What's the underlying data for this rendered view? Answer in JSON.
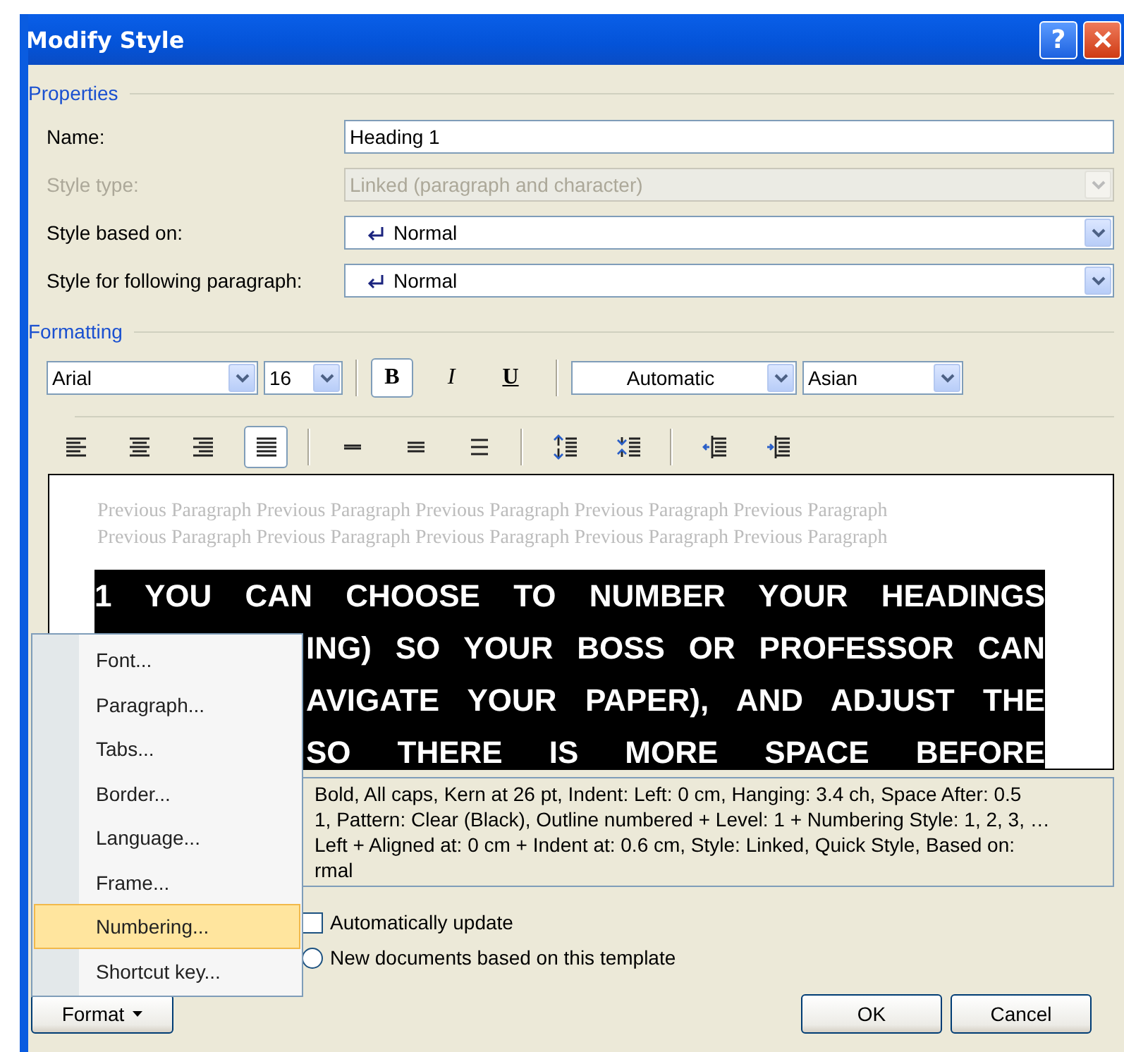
{
  "window": {
    "title": "Modify Style",
    "help": "?"
  },
  "properties": {
    "legend": "Properties",
    "fields": [
      {
        "label": "Name:",
        "kind": "text",
        "value": "Heading 1",
        "disabled": false
      },
      {
        "label": "Style type:",
        "kind": "select",
        "value": "Linked (paragraph and character)",
        "disabled": true
      },
      {
        "label": "Style based on:",
        "kind": "style-select",
        "value": "Normal",
        "disabled": false
      },
      {
        "label": "Style for following paragraph:",
        "kind": "style-select",
        "value": "Normal",
        "disabled": false
      }
    ]
  },
  "formatting": {
    "legend": "Formatting",
    "font": "Arial",
    "size": "16",
    "styles": [
      {
        "label": "B",
        "kind": "bold",
        "selected": true
      },
      {
        "label": "I",
        "kind": "italic",
        "selected": false
      },
      {
        "label": "U",
        "kind": "underline",
        "selected": false
      }
    ],
    "font_color": "Automatic",
    "script": "Asian",
    "tools": [
      {
        "kind": "align-left",
        "selected": false
      },
      {
        "kind": "align-center",
        "selected": false
      },
      {
        "kind": "align-right",
        "selected": false
      },
      {
        "kind": "justify",
        "selected": true
      },
      {
        "kind": "sep"
      },
      {
        "kind": "single-spacing",
        "selected": false
      },
      {
        "kind": "onehalf-spacing",
        "selected": false
      },
      {
        "kind": "double-spacing",
        "selected": false
      },
      {
        "kind": "sep"
      },
      {
        "kind": "space-before",
        "selected": false
      },
      {
        "kind": "space-after",
        "selected": false
      },
      {
        "kind": "sep"
      },
      {
        "kind": "decrease-indent",
        "selected": false
      },
      {
        "kind": "increase-indent",
        "selected": false
      }
    ]
  },
  "preview": {
    "previous": [
      "Previous Paragraph Previous Paragraph Previous Paragraph Previous Paragraph Previous Paragraph",
      "Previous Paragraph Previous Paragraph Previous Paragraph Previous Paragraph Previous Paragraph"
    ],
    "heading": [
      "1 YOU CAN CHOOSE TO NUMBER YOUR HEADINGS",
      "ING) SO YOUR BOSS OR PROFESSOR CAN",
      "AVIGATE YOUR PAPER), AND ADJUST THE",
      "SO THERE IS MORE SPACE BEFORE"
    ]
  },
  "description": [
    "Bold, All caps, Kern at 26 pt, Indent: Left:  0 cm, Hanging:  3.4 ch, Space After:  0.5",
    "1, Pattern: Clear (Black), Outline numbered + Level: 1 + Numbering Style: 1, 2, 3, …",
    "Left + Aligned at:  0 cm + Indent at:  0.6 cm, Style: Linked, Quick Style, Based on:",
    "rmal"
  ],
  "options": [
    {
      "kind": "checkbox",
      "label": "Automatically update",
      "checked": false
    },
    {
      "kind": "radio",
      "label": "New documents based on this template",
      "selected": false
    }
  ],
  "menu": [
    {
      "label": "Font...",
      "selected": false
    },
    {
      "label": "Paragraph...",
      "selected": false
    },
    {
      "label": "Tabs...",
      "selected": false
    },
    {
      "label": "Border...",
      "selected": false
    },
    {
      "label": "Language...",
      "selected": false
    },
    {
      "label": "Frame...",
      "selected": false
    },
    {
      "label": "Numbering...",
      "selected": true
    },
    {
      "label": "Shortcut key...",
      "selected": false
    }
  ],
  "format_button": "Format",
  "buttons": [
    "OK",
    "Cancel"
  ]
}
